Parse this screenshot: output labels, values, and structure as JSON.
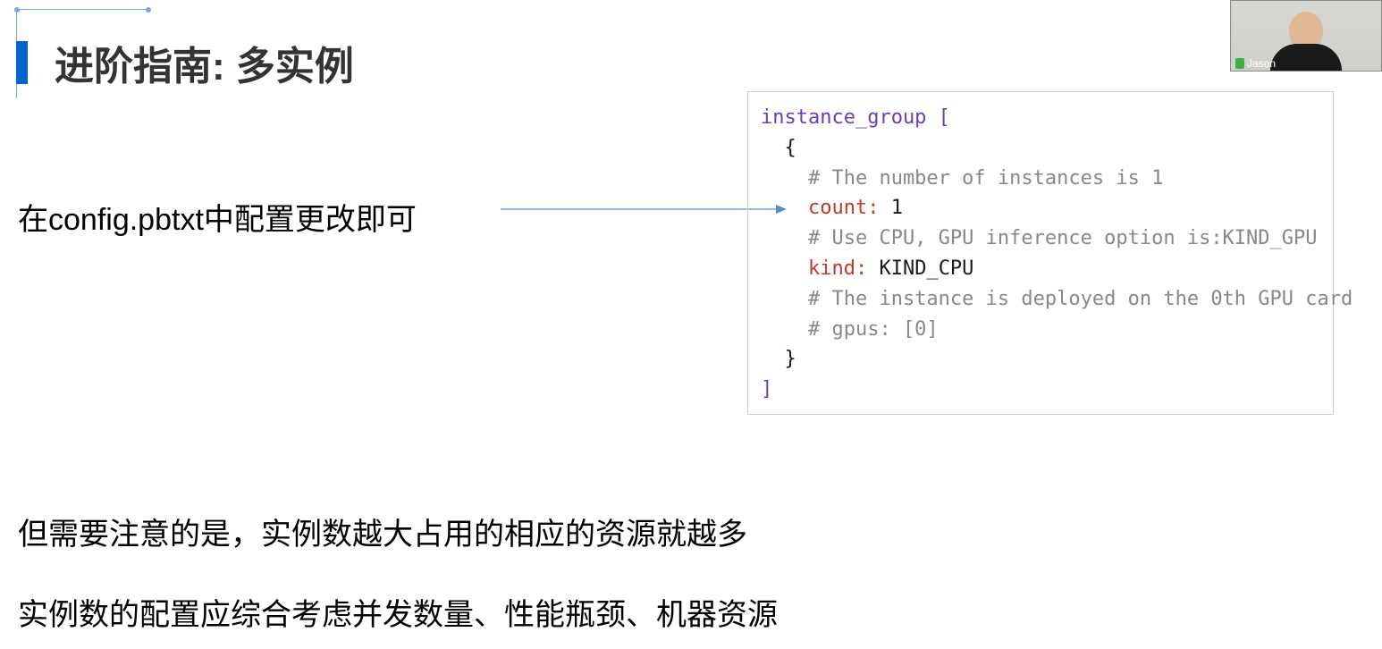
{
  "title": "进阶指南: 多实例",
  "description": "在config.pbtxt中配置更改即可",
  "code": {
    "line1_kw": "instance_group",
    "line1_bracket": " [",
    "line2": "  {",
    "line3": "    # The number of instances is 1",
    "line4_key": "    count:",
    "line4_val": " 1",
    "line5": "    # Use CPU, GPU inference option is:KIND_GPU",
    "line6_key": "    kind:",
    "line6_val": " KIND_CPU",
    "line7": "    # The instance is deployed on the 0th GPU card",
    "line8": "    # gpus: [0]",
    "line9": "  }",
    "line10": "]"
  },
  "note1": "但需要注意的是，实例数越大占用的相应的资源就越多",
  "note2": "实例数的配置应综合考虑并发数量、性能瓶颈、机器资源",
  "webcam_name": "Jason"
}
